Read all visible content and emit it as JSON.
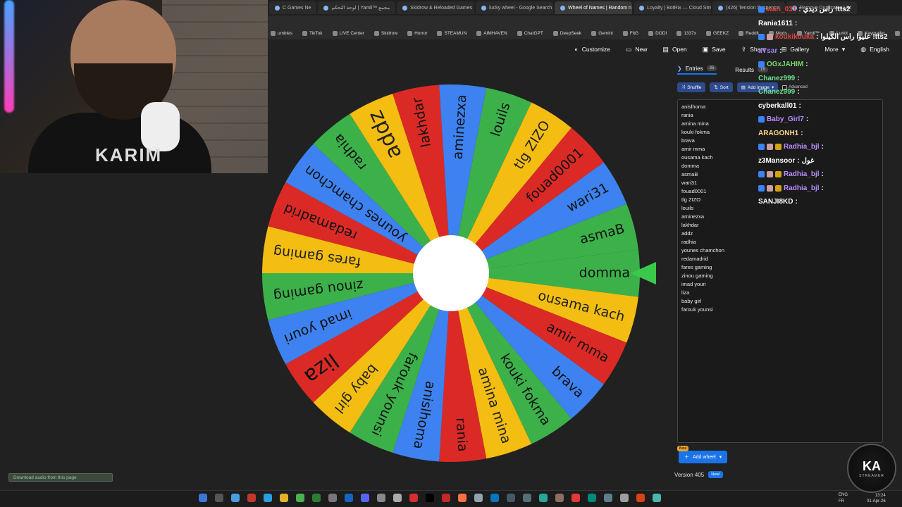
{
  "browser": {
    "tabs": [
      {
        "label": "C Games Ne",
        "active": false
      },
      {
        "label": "لوحة التحكم | Yamli™ مجمع",
        "active": false
      },
      {
        "label": "Skidrow & Reloaded Games",
        "active": false
      },
      {
        "label": "lucky wheel - Google Search",
        "active": false
      },
      {
        "label": "Wheel of Names | Random n",
        "active": true
      },
      {
        "label": "Loyalty | BotRix — Cloud Stre",
        "active": false
      },
      {
        "label": "(426) Tension Suspence",
        "active": false
      },
      {
        "label": "Remove Duplicates List",
        "active": false
      }
    ],
    "bookmarks": [
      "umbles",
      "TikTok",
      "LIVE Center",
      "Skidrow",
      "Horror",
      "STEAMUN",
      "AIMHAVEN",
      "ChatGPT",
      "DeepSeek",
      "Gemini",
      "FitG",
      "DODI",
      "1337x",
      "GEEKZ",
      "Reddit",
      "Mods",
      "Yamli™",
      "Lurkit",
      "Keymailer",
      "Other favorites"
    ]
  },
  "toolbar": {
    "customize": "Customize",
    "new": "New",
    "open": "Open",
    "save": "Save",
    "share": "Share",
    "gallery": "Gallery",
    "more": "More",
    "language": "English"
  },
  "panel": {
    "entries_tab": "Entries",
    "entries_count": "35",
    "results_tab": "Results",
    "results_count": "16",
    "shuffle": "Shuffle",
    "sort": "Sort",
    "add_image": "Add image",
    "advanced": "Advanced",
    "beta": "Beta",
    "add_wheel": "Add wheel",
    "version": "Version 405",
    "new_badge": "New!"
  },
  "entries": [
    "anislhoma",
    "rania",
    "amina mina",
    "kouki fokma",
    "brava",
    "amir mma",
    "ousama kach",
    "domma",
    "asmaB",
    "wari31",
    "fouad0001",
    "tlg ZIZO",
    "louils",
    "aminezxa",
    "lakhdar",
    "addz",
    "radhia",
    "younes chamchon",
    "redamadrid",
    "fares gaming",
    "zinou gaming",
    "imad youri",
    "liza",
    "baby girl",
    "farouk younsi"
  ],
  "wheel": {
    "segments_clockwise_from_east": [
      "domma",
      "ousama kach",
      "amir mma",
      "brava",
      "kouki fokma",
      "amina mina",
      "rania",
      "anislhoma",
      "farouk younsi",
      "baby girl",
      "liza",
      "imad youri",
      "zinou gaming",
      "fares gaming",
      "redamadrid",
      "younes chamchon",
      "radhia",
      "addz",
      "lakhdar",
      "aminezxa",
      "louils",
      "tlg ZIZO",
      "fouad0001",
      "wari31",
      "asmaB"
    ],
    "colors": [
      "#3cb14a",
      "#f3bd12",
      "#db2a26",
      "#3d82f0"
    ]
  },
  "chat": [
    {
      "user": "wari_031",
      "text": "راس ديدي !tts2",
      "color": "#e04040",
      "badges": 1
    },
    {
      "user": "Rania1611",
      "text": "",
      "color": "#ffffff",
      "badges": 0
    },
    {
      "user": "koukikouka",
      "text": "عليوا راس الكيلوا !tts2",
      "color": "#e04040",
      "badges": 2
    },
    {
      "user": "aYsar",
      "text": "",
      "color": "#a77cff",
      "badges": 0
    },
    {
      "user": "OGxJAHIM",
      "text": "",
      "color": "#7bd66b",
      "badges": 1
    },
    {
      "user": "Chanez999",
      "text": "",
      "color": "#6ee08f",
      "badges": 0
    },
    {
      "user": "Chanez999",
      "text": "",
      "color": "#6ee08f",
      "badges": 0
    },
    {
      "user": "cyberkall01",
      "text": "",
      "color": "#ffffff",
      "badges": 0
    },
    {
      "user": "Baby_Girl7",
      "text": "",
      "color": "#b98dff",
      "badges": 1
    },
    {
      "user": "ARAGONH1",
      "text": "",
      "color": "#ffd28a",
      "badges": 0
    },
    {
      "user": "Radhia_bjl",
      "text": "",
      "color": "#b98dff",
      "badges": 3
    },
    {
      "user": "z3Mansoor",
      "text": "غول",
      "color": "#ffffff",
      "badges": 0
    },
    {
      "user": "Radhia_bjl",
      "text": "",
      "color": "#b98dff",
      "badges": 3
    },
    {
      "user": "Radhia_bjl",
      "text": "",
      "color": "#b98dff",
      "badges": 3
    },
    {
      "user": "SANJI8KD",
      "text": "",
      "color": "#ffffff",
      "badges": 0
    }
  ],
  "download": "Download audio from this page",
  "stream_overlay": {
    "shirt_text": "KARIM"
  },
  "logo": {
    "mark": "KA",
    "sub": "STREAMER"
  },
  "system": {
    "lang": "ENG",
    "region": "FR",
    "time": "13:24",
    "date": "01-Apr-26"
  }
}
